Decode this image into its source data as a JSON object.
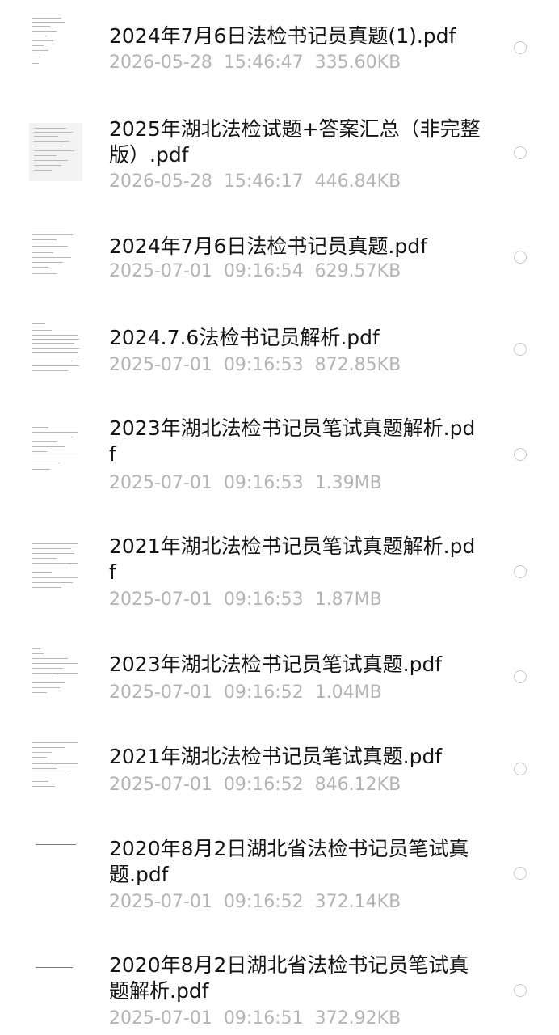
{
  "files": [
    {
      "title": "2024年7月6日法检书记员真题(1).pdf",
      "date": "2026-05-28",
      "time": "15:46:47",
      "size": "335.60KB",
      "selected": false,
      "thumbnail_icon": "pdf-page-thumbnail"
    },
    {
      "title": "2025年湖北法检试题+答案汇总（非完整版）.pdf",
      "date": "2026-05-28",
      "time": "15:46:17",
      "size": "446.84KB",
      "selected": false,
      "thumbnail_icon": "pdf-page-thumbnail"
    },
    {
      "title": "2024年7月6日法检书记员真题.pdf",
      "date": "2025-07-01",
      "time": "09:16:54",
      "size": "629.57KB",
      "selected": false,
      "thumbnail_icon": "pdf-page-thumbnail"
    },
    {
      "title": "2024.7.6法检书记员解析.pdf",
      "date": "2025-07-01",
      "time": "09:16:53",
      "size": "872.85KB",
      "selected": false,
      "thumbnail_icon": "pdf-page-thumbnail"
    },
    {
      "title": "2023年湖北法检书记员笔试真题解析.pdf",
      "date": "2025-07-01",
      "time": "09:16:53",
      "size": "1.39MB",
      "selected": false,
      "thumbnail_icon": "pdf-page-thumbnail"
    },
    {
      "title": "2021年湖北法检书记员笔试真题解析.pdf",
      "date": "2025-07-01",
      "time": "09:16:53",
      "size": "1.87MB",
      "selected": false,
      "thumbnail_icon": "pdf-page-thumbnail"
    },
    {
      "title": "2023年湖北法检书记员笔试真题.pdf",
      "date": "2025-07-01",
      "time": "09:16:52",
      "size": "1.04MB",
      "selected": false,
      "thumbnail_icon": "pdf-page-thumbnail"
    },
    {
      "title": "2021年湖北法检书记员笔试真题.pdf",
      "date": "2025-07-01",
      "time": "09:16:52",
      "size": "846.12KB",
      "selected": false,
      "thumbnail_icon": "pdf-page-thumbnail"
    },
    {
      "title": "2020年8月2日湖北省法检书记员笔试真题.pdf",
      "date": "2025-07-01",
      "time": "09:16:52",
      "size": "372.14KB",
      "selected": false,
      "thumbnail_icon": "pdf-page-thumbnail"
    },
    {
      "title": "2020年8月2日湖北省法检书记员笔试真题解析.pdf",
      "date": "2025-07-01",
      "time": "09:16:51",
      "size": "372.92KB",
      "selected": false,
      "thumbnail_icon": "pdf-page-thumbnail"
    }
  ]
}
